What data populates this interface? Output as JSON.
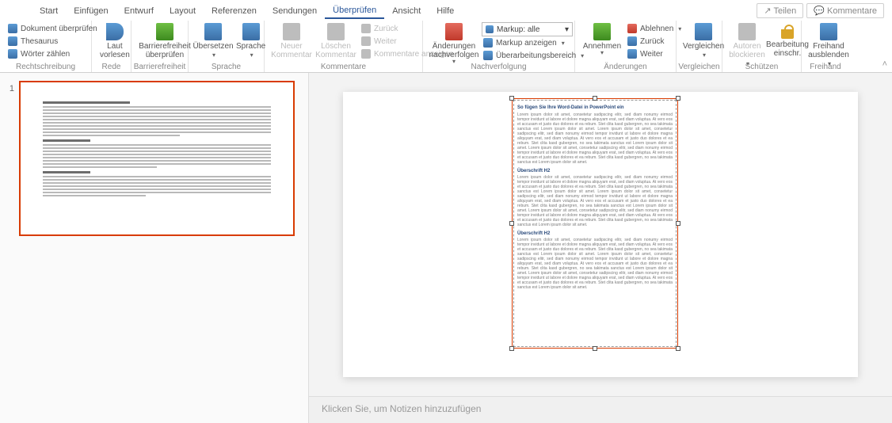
{
  "tabs": {
    "items": [
      "Start",
      "Einfügen",
      "Entwurf",
      "Layout",
      "Referenzen",
      "Sendungen",
      "Überprüfen",
      "Ansicht",
      "Hilfe"
    ],
    "active_index": 6,
    "share": "Teilen",
    "comments": "Kommentare"
  },
  "ribbon": {
    "spelling": {
      "label": "Rechtschreibung",
      "items": [
        "Dokument überprüfen",
        "Thesaurus",
        "Wörter zählen"
      ]
    },
    "speech": {
      "label": "Rede",
      "read_aloud": "Laut vorlesen"
    },
    "a11y": {
      "label": "Barrierefreiheit",
      "check": "Barrierefreiheit überprüfen"
    },
    "language": {
      "label": "Sprache",
      "translate": "Übersetzen",
      "lang": "Sprache"
    },
    "comments": {
      "label": "Kommentare",
      "new": "Neuer Kommentar",
      "del": "Löschen Kommentar",
      "prev": "Zurück",
      "next": "Weiter",
      "show": "Kommentare anzeigen"
    },
    "tracking": {
      "label": "Nachverfolgung",
      "track": "Änderungen nachverfolgen",
      "markup_label": "Markup: alle",
      "show_markup": "Markup anzeigen",
      "review_pane": "Überarbeitungsbereich"
    },
    "changes": {
      "label": "Änderungen",
      "accept": "Annehmen",
      "reject": "Ablehnen",
      "prev": "Zurück",
      "next": "Weiter"
    },
    "compare": {
      "label": "Vergleichen",
      "compare": "Vergleichen"
    },
    "protect": {
      "label": "Schützen",
      "block_authors": "Autoren blockieren",
      "restrict": "Bearbeitung einschr."
    },
    "ink": {
      "label": "Freihand",
      "hide": "Freihand ausblenden"
    }
  },
  "thumb": {
    "number": "1"
  },
  "document": {
    "title": "So fügen Sie Ihre Word-Datei in PowerPoint ein",
    "sub1": "Überschrift H2",
    "sub2": "Überschrift H2",
    "lorem": "Lorem ipsum dolor sit amet, consetetur sadipscing elitr, sed diam nonumy eirmod tempor invidunt ut labore et dolore magna aliquyam erat, sed diam voluptua. At vero eos et accusam et justo duo dolores et ea rebum. Stet clita kasd gubergren, no sea takimata sanctus est Lorem ipsum dolor sit amet. Lorem ipsum dolor sit amet, consetetur sadipscing elitr, sed diam nonumy eirmod tempor invidunt ut labore et dolore magna aliquyam erat, sed diam voluptua. At vero eos et accusam et justo duo dolores et ea rebum. Stet clita kasd gubergren, no sea takimata sanctus est Lorem ipsum dolor sit amet. Lorem ipsum dolor sit amet, consetetur sadipscing elitr, sed diam nonumy eirmod tempor invidunt ut labore et dolore magna aliquyam erat, sed diam voluptua. At vero eos et accusam et justo duo dolores et ea rebum. Stet clita kasd gubergren, no sea takimata sanctus est Lorem ipsum dolor sit amet."
  },
  "notes": {
    "placeholder": "Klicken Sie, um Notizen hinzuzufügen"
  }
}
